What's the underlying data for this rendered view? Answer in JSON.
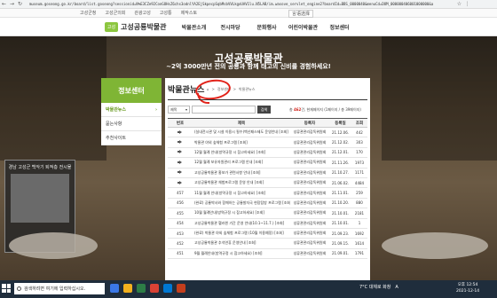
{
  "browser": {
    "url": "museum.goseong.go.kr/board/list.goseong?sessionid=N%E3CZe92ConGOHsZ6chs3odnlYA2EjSkpecpSqbMsbVVLkgoUAV1lu.N5LAB/im.wasove_servlet_engine2?boardId=BBS_0000040&menuCd=DOM_000000406001000000&a",
    "back_icon": "arrow-left-icon",
    "forward_icon": "arrow-right-icon",
    "reload_icon": "reload-icon"
  },
  "gov_bar": {
    "links": [
      "고성군청",
      "고성군의회",
      "관광고성",
      "고성통",
      "제작스토"
    ],
    "lang": "言语选择"
  },
  "header": {
    "logo_text": "고성공룡박물관",
    "logo_mark": "고성",
    "menu": [
      "박물관소개",
      "전시마당",
      "문화행사",
      "어린이박물관",
      "정보센터"
    ]
  },
  "hero": {
    "title": "고성공룡박물관",
    "subtitle": "~2억 3000만년 전의 공룡과 함께 태고의 신비를 경험하세요!",
    "panel_caption": "경남 고성군 백악기 퇴적층 전시물"
  },
  "sidebar": {
    "title": "정보센터",
    "items": [
      {
        "label": "박물관뉴스",
        "active": true
      },
      {
        "label": "묻는사항",
        "active": false
      },
      {
        "label": "추천사이트",
        "active": false
      }
    ]
  },
  "main": {
    "page_title": "박물관뉴스",
    "breadcrumb": [
      "⌂",
      ">",
      "정보센터",
      ">",
      "박물관뉴스"
    ],
    "search": {
      "select_value": "제목",
      "input_value": "",
      "button_label": "검색"
    },
    "count_prefix": "총",
    "count_number": "462",
    "count_suffix": "건, 현재페이지 (1페이지 / 총 39페이지)",
    "columns": [
      "번호",
      "제목",
      "등록자",
      "등록일",
      "조회"
    ],
    "rows": [
      {
        "no": "",
        "notice": true,
        "title": "(실내전시관 및 시설 이용시 필수)백신패스제도 운영안내 [조회]",
        "author": "성류관관리감독위원회",
        "date": "21.12.06.",
        "views": "442"
      },
      {
        "no": "",
        "notice": true,
        "title": "박물관 야외 숲체험 프로그램 [조회]",
        "author": "성류관관리감독위원회",
        "date": "21.12.02.",
        "views": "303"
      },
      {
        "no": "",
        "notice": true,
        "title": "12월 월례 안내(방역규정 시 참고하세요) [조회]",
        "author": "성류관관리감독위원회",
        "date": "21.12.01.",
        "views": "170"
      },
      {
        "no": "",
        "notice": true,
        "title": "12월 월례 보유자원관리 프로그램 안내 [조회]",
        "author": "성류관관리감독위원회",
        "date": "21.11.26.",
        "views": "1973"
      },
      {
        "no": "",
        "notice": true,
        "title": "고성공룡박물관 홍보가 관련사항 안내 [조회]",
        "author": "성류관관리감독위원회",
        "date": "21.10.27.",
        "views": "1171"
      },
      {
        "no": "",
        "notice": true,
        "title": "고성공룡박물관 체험프로그램 운영 안내 [조회]",
        "author": "성류관관리감독위원회",
        "date": "21.06.02.",
        "views": "4484"
      },
      {
        "no": "457",
        "notice": false,
        "title": "11월 월례 안내(방역규정 시 참고하세요) [조회]",
        "author": "성류관관리감독위원회",
        "date": "21.11.01.",
        "views": "259"
      },
      {
        "no": "456",
        "notice": false,
        "title": "(완료) 공룡박사와 함께하는 공룡발자국 현장탐방 프로그램 [조회]",
        "author": "성류관관리감독위원회",
        "date": "21.10.20.",
        "views": "880"
      },
      {
        "no": "455",
        "notice": false,
        "title": "10월 월례안내(방역규정 시 참고하세요) [조회]",
        "author": "성류관관리감독위원회",
        "date": "21.10.01.",
        "views": "2181"
      },
      {
        "no": "454",
        "notice": false,
        "title": "고성공룡박물관 핼러윈 기간 운영 안내(10.1~11.7.) [조회]",
        "author": "성류관관리감독위원회",
        "date": "21.10.01.",
        "views": "1"
      },
      {
        "no": "453",
        "notice": false,
        "title": "(완료) 박물관 야외 숲체험 프로그램 (10월 이용예정) [조회]",
        "author": "성류관관리감독위원회",
        "date": "21.09.23.",
        "views": "1692"
      },
      {
        "no": "452",
        "notice": false,
        "title": "고성공룡박물관 추석연휴 운영안내 [조회]",
        "author": "성류관관리감독위원회",
        "date": "21.09.15.",
        "views": "1614"
      },
      {
        "no": "451",
        "notice": false,
        "title": "9월 월례안내(방역규정 시 참고하세요) [조회]",
        "author": "성류관관리감독위원회",
        "date": "21.09.01.",
        "views": "1791"
      }
    ]
  },
  "taskbar": {
    "search_placeholder": "검색하려면 여기에 입력하십시오.",
    "app_colors": [
      "#3b78e7",
      "#f2b01e",
      "#2d7d46",
      "#d94235",
      "#0078d4",
      "#c43e1c"
    ],
    "weather": "7°C 대체로 화창",
    "lang": "A",
    "time": "오후 12:54",
    "date": "2021-12-14"
  }
}
